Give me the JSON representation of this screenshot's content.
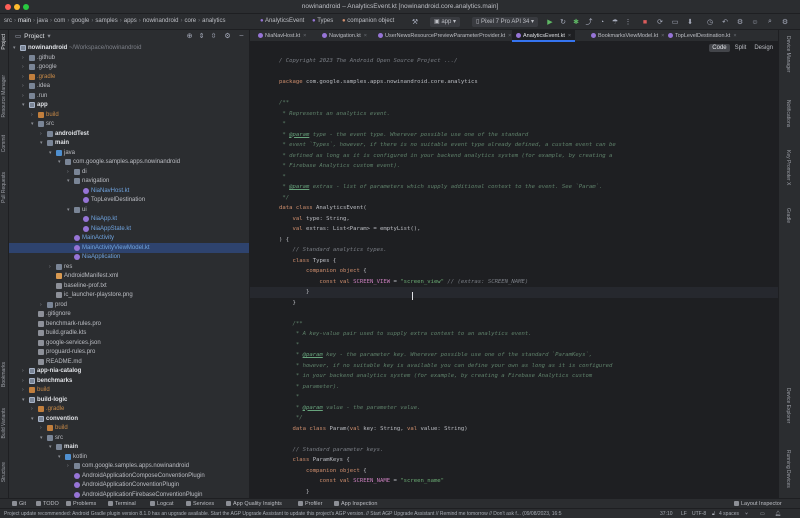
{
  "window": {
    "title": "nowinandroid – AnalyticsEvent.kt [nowinandroid.core.analytics.main]"
  },
  "toolbar": {
    "breadcrumbs": [
      "src",
      "main",
      "java",
      "com",
      "google",
      "samples",
      "apps",
      "nowinandroid",
      "core",
      "analytics"
    ],
    "file_crumb": "AnalyticsEvent",
    "types_crumb": "Types",
    "companion_crumb": "companion object",
    "run_config": "app",
    "device": "Pixel 7 Pro API 34"
  },
  "stripes": {
    "left": [
      "Project",
      "Resource Manager",
      "Commit",
      "Pull Requests",
      "Bookmarks",
      "Build Variants",
      "Structure"
    ],
    "right": [
      "Device Manager",
      "Notifications",
      "Key Promoter X",
      "Gradle",
      "Device Explorer",
      "Running Devices"
    ]
  },
  "project_panel": {
    "title": "Project",
    "tree": [
      {
        "d": 0,
        "arrow": "v",
        "icon": "module",
        "text": "nowinandroid",
        "suffix": " ~/Workspace/nowinandroid",
        "style": "bold"
      },
      {
        "d": 1,
        "arrow": ">",
        "icon": "folder",
        "text": ".github",
        "style": "norm"
      },
      {
        "d": 1,
        "arrow": ">",
        "icon": "folder",
        "text": ".google",
        "style": "norm"
      },
      {
        "d": 1,
        "arrow": ">",
        "icon": "build",
        "text": ".gradle",
        "style": "orange"
      },
      {
        "d": 1,
        "arrow": ">",
        "icon": "folder",
        "text": ".idea",
        "style": "norm"
      },
      {
        "d": 1,
        "arrow": ">",
        "icon": "folder",
        "text": ".run",
        "style": "norm"
      },
      {
        "d": 1,
        "arrow": "v",
        "icon": "module",
        "text": "app",
        "style": "bold"
      },
      {
        "d": 2,
        "arrow": ">",
        "icon": "build",
        "text": "build",
        "style": "orange"
      },
      {
        "d": 2,
        "arrow": "v",
        "icon": "folder",
        "text": "src",
        "style": "norm"
      },
      {
        "d": 3,
        "arrow": ">",
        "icon": "folder",
        "text": "androidTest",
        "style": "bold"
      },
      {
        "d": 3,
        "arrow": "v",
        "icon": "folder",
        "text": "main",
        "style": "bold"
      },
      {
        "d": 4,
        "arrow": "v",
        "icon": "src",
        "text": "java",
        "style": "norm"
      },
      {
        "d": 5,
        "arrow": "v",
        "icon": "folder",
        "text": "com.google.samples.apps.nowinandroid",
        "style": "norm"
      },
      {
        "d": 6,
        "arrow": ">",
        "icon": "folder",
        "text": "di",
        "style": "norm"
      },
      {
        "d": 6,
        "arrow": "v",
        "icon": "folder",
        "text": "navigation",
        "style": "norm"
      },
      {
        "d": 7,
        "arrow": "",
        "icon": "kt",
        "text": "NiaNavHost.kt",
        "style": "blue"
      },
      {
        "d": 7,
        "arrow": "",
        "icon": "kt",
        "text": "TopLevelDestination",
        "style": "norm"
      },
      {
        "d": 6,
        "arrow": "v",
        "icon": "folder",
        "text": "ui",
        "style": "norm"
      },
      {
        "d": 7,
        "arrow": "",
        "icon": "kt",
        "text": "NiaApp.kt",
        "style": "blue"
      },
      {
        "d": 7,
        "arrow": "",
        "icon": "kt",
        "text": "NiaAppState.kt",
        "style": "blue"
      },
      {
        "d": 6,
        "arrow": "",
        "icon": "kt",
        "text": "MainActivity",
        "style": "blue"
      },
      {
        "d": 6,
        "arrow": "",
        "icon": "kt",
        "text": "MainActivityViewModel.kt",
        "style": "blue",
        "selected": true
      },
      {
        "d": 6,
        "arrow": "",
        "icon": "kt",
        "text": "NiaApplication",
        "style": "blue"
      },
      {
        "d": 4,
        "arrow": ">",
        "icon": "folder",
        "text": "res",
        "style": "norm"
      },
      {
        "d": 4,
        "arrow": "",
        "icon": "xml",
        "text": "AndroidManifest.xml",
        "style": "norm"
      },
      {
        "d": 4,
        "arrow": "",
        "icon": "file",
        "text": "baseline-prof.txt",
        "style": "norm"
      },
      {
        "d": 4,
        "arrow": "",
        "icon": "file",
        "text": "ic_launcher-playstore.png",
        "style": "norm"
      },
      {
        "d": 3,
        "arrow": ">",
        "icon": "folder",
        "text": "prod",
        "style": "norm"
      },
      {
        "d": 2,
        "arrow": "",
        "icon": "file",
        "text": ".gitignore",
        "style": "norm"
      },
      {
        "d": 2,
        "arrow": "",
        "icon": "file",
        "text": "benchmark-rules.pro",
        "style": "norm"
      },
      {
        "d": 2,
        "arrow": "",
        "icon": "file",
        "text": "build.gradle.kts",
        "style": "norm"
      },
      {
        "d": 2,
        "arrow": "",
        "icon": "file",
        "text": "google-services.json",
        "style": "norm"
      },
      {
        "d": 2,
        "arrow": "",
        "icon": "file",
        "text": "proguard-rules.pro",
        "style": "norm"
      },
      {
        "d": 2,
        "arrow": "",
        "icon": "file",
        "text": "README.md",
        "style": "norm"
      },
      {
        "d": 1,
        "arrow": ">",
        "icon": "module",
        "text": "app-nia-catalog",
        "style": "bold"
      },
      {
        "d": 1,
        "arrow": ">",
        "icon": "module",
        "text": "benchmarks",
        "style": "bold"
      },
      {
        "d": 1,
        "arrow": ">",
        "icon": "build",
        "text": "build",
        "style": "orange"
      },
      {
        "d": 1,
        "arrow": "v",
        "icon": "module",
        "text": "build-logic",
        "style": "bold"
      },
      {
        "d": 2,
        "arrow": ">",
        "icon": "build",
        "text": ".gradle",
        "style": "orange"
      },
      {
        "d": 2,
        "arrow": "v",
        "icon": "module",
        "text": "convention",
        "style": "bold"
      },
      {
        "d": 3,
        "arrow": ">",
        "icon": "build",
        "text": "build",
        "style": "orange"
      },
      {
        "d": 3,
        "arrow": "v",
        "icon": "folder",
        "text": "src",
        "style": "norm"
      },
      {
        "d": 4,
        "arrow": "v",
        "icon": "folder",
        "text": "main",
        "style": "bold"
      },
      {
        "d": 5,
        "arrow": "v",
        "icon": "src",
        "text": "kotlin",
        "style": "norm"
      },
      {
        "d": 6,
        "arrow": ">",
        "icon": "folder",
        "text": "com.google.samples.apps.nowinandroid",
        "style": "norm"
      },
      {
        "d": 6,
        "arrow": "",
        "icon": "kt",
        "text": "AndroidApplicationComposeConventionPlugin",
        "style": "norm"
      },
      {
        "d": 6,
        "arrow": "",
        "icon": "kt",
        "text": "AndroidApplicationConventionPlugin",
        "style": "norm"
      },
      {
        "d": 6,
        "arrow": "",
        "icon": "kt",
        "text": "AndroidApplicationFirebaseConventionPlugin",
        "style": "norm"
      }
    ]
  },
  "tabs": [
    {
      "label": "NiaNavHost.kt",
      "active": false
    },
    {
      "label": "Navigation.kt",
      "active": false
    },
    {
      "label": "UserNewsResourcePreviewParameterProvider.kt",
      "active": false
    },
    {
      "label": "AnalyticsEvent.kt",
      "active": true
    },
    {
      "label": "BookmarksViewModel.kt",
      "active": false
    },
    {
      "label": "TopLevelDestination.kt",
      "active": false
    }
  ],
  "view_toggle": [
    "Code",
    "Split",
    "Design"
  ],
  "code_lines": [
    [
      [
        "cm",
        "/ Copyright 2023 The Android Open Source Project .../"
      ]
    ],
    [],
    [
      [
        "kw",
        "package "
      ],
      [
        "id",
        "com.google.samples.apps.nowinandroid.core.analytics"
      ]
    ],
    [],
    [
      [
        "doc",
        "/**"
      ]
    ],
    [
      [
        "doc",
        " * Represents an analytics event."
      ]
    ],
    [
      [
        "doc",
        " *"
      ]
    ],
    [
      [
        "doc",
        " * "
      ],
      [
        "tag",
        "@param"
      ],
      [
        "doc",
        " type - the event type. Wherever possible use one of the standard"
      ]
    ],
    [
      [
        "doc",
        " * event `Types`, however, if there is no suitable event type already defined, a custom event can be"
      ]
    ],
    [
      [
        "doc",
        " * defined as long as it is configured in your backend analytics system (for example, by creating a"
      ]
    ],
    [
      [
        "doc",
        " * Firebase Analytics custom event)."
      ]
    ],
    [
      [
        "doc",
        " *"
      ]
    ],
    [
      [
        "doc",
        " * "
      ],
      [
        "tag",
        "@param"
      ],
      [
        "doc",
        " extras - list of parameters which supply additional context to the event. See `Param`."
      ]
    ],
    [
      [
        "doc",
        " */"
      ]
    ],
    [
      [
        "kw",
        "data class "
      ],
      [
        "id",
        "AnalyticsEvent("
      ]
    ],
    [
      [
        "id",
        "    "
      ],
      [
        "kw",
        "val "
      ],
      [
        "id",
        "type: String,"
      ]
    ],
    [
      [
        "id",
        "    "
      ],
      [
        "kw",
        "val "
      ],
      [
        "id",
        "extras: List<Param> = emptyList(),"
      ]
    ],
    [
      [
        "id",
        ") {"
      ]
    ],
    [
      [
        "cm",
        "    // Standard analytics types."
      ]
    ],
    [
      [
        "id",
        "    "
      ],
      [
        "kw",
        "class "
      ],
      [
        "id",
        "Types {"
      ]
    ],
    [
      [
        "id",
        "        "
      ],
      [
        "kw",
        "companion object "
      ],
      [
        "id",
        "{"
      ]
    ],
    [
      [
        "id",
        "            "
      ],
      [
        "kw",
        "const val "
      ],
      [
        "prop",
        "SCREEN_VIEW"
      ],
      [
        "id",
        " = "
      ],
      [
        "str",
        "\"screen_view\""
      ],
      [
        "cm",
        " // (extras: SCREEN_NAME)"
      ]
    ],
    [
      [
        "id",
        "        }"
      ]
    ],
    [
      [
        "id",
        "    }"
      ]
    ],
    [],
    [
      [
        "doc",
        "    /**"
      ]
    ],
    [
      [
        "doc",
        "     * A key-value pair used to supply extra context to an analytics event."
      ]
    ],
    [
      [
        "doc",
        "     *"
      ]
    ],
    [
      [
        "doc",
        "     * "
      ],
      [
        "tag",
        "@param"
      ],
      [
        "doc",
        " key - the parameter key. Wherever possible use one of the standard `ParamKeys`,"
      ]
    ],
    [
      [
        "doc",
        "     * however, if no suitable key is available you can define your own as long as it is configured"
      ]
    ],
    [
      [
        "doc",
        "     * in your backend analytics system (for example, by creating a Firebase Analytics custom"
      ]
    ],
    [
      [
        "doc",
        "     * parameter)."
      ]
    ],
    [
      [
        "doc",
        "     *"
      ]
    ],
    [
      [
        "doc",
        "     * "
      ],
      [
        "tag",
        "@param"
      ],
      [
        "doc",
        " value - the parameter value."
      ]
    ],
    [
      [
        "doc",
        "     */"
      ]
    ],
    [
      [
        "id",
        "    "
      ],
      [
        "kw",
        "data class "
      ],
      [
        "id",
        "Param("
      ],
      [
        "kw",
        "val "
      ],
      [
        "id",
        "key: String, "
      ],
      [
        "kw",
        "val "
      ],
      [
        "id",
        "value: String)"
      ]
    ],
    [],
    [
      [
        "cm",
        "    // Standard parameter keys."
      ]
    ],
    [
      [
        "id",
        "    "
      ],
      [
        "kw",
        "class "
      ],
      [
        "id",
        "ParamKeys {"
      ]
    ],
    [
      [
        "id",
        "        "
      ],
      [
        "kw",
        "companion object "
      ],
      [
        "id",
        "{"
      ]
    ],
    [
      [
        "id",
        "            "
      ],
      [
        "kw",
        "const val "
      ],
      [
        "prop",
        "SCREEN_NAME"
      ],
      [
        "id",
        " = "
      ],
      [
        "str",
        "\"screen_name\""
      ]
    ],
    [
      [
        "id",
        "        }"
      ]
    ]
  ],
  "current_line_index": 22,
  "bottom_tools": [
    "Git",
    "TODO",
    "Problems",
    "Terminal",
    "Logcat",
    "Services",
    "App Quality Insights",
    "Profiler",
    "App Inspection"
  ],
  "layout_inspector": "Layout Inspector",
  "status": {
    "message": "Project update recommended: Android Gradle plugin version 8.1.0 has an upgrade available. Start the AGP Upgrade Assistant to update this project's AGP version. // Start AGP Upgrade Assistant // Remind me tomorrow // Don't ask f... (09/08/2023, 16:5",
    "position": "37:10",
    "line_sep": "LF",
    "encoding": "UTF-8",
    "indent": "4 spaces"
  }
}
